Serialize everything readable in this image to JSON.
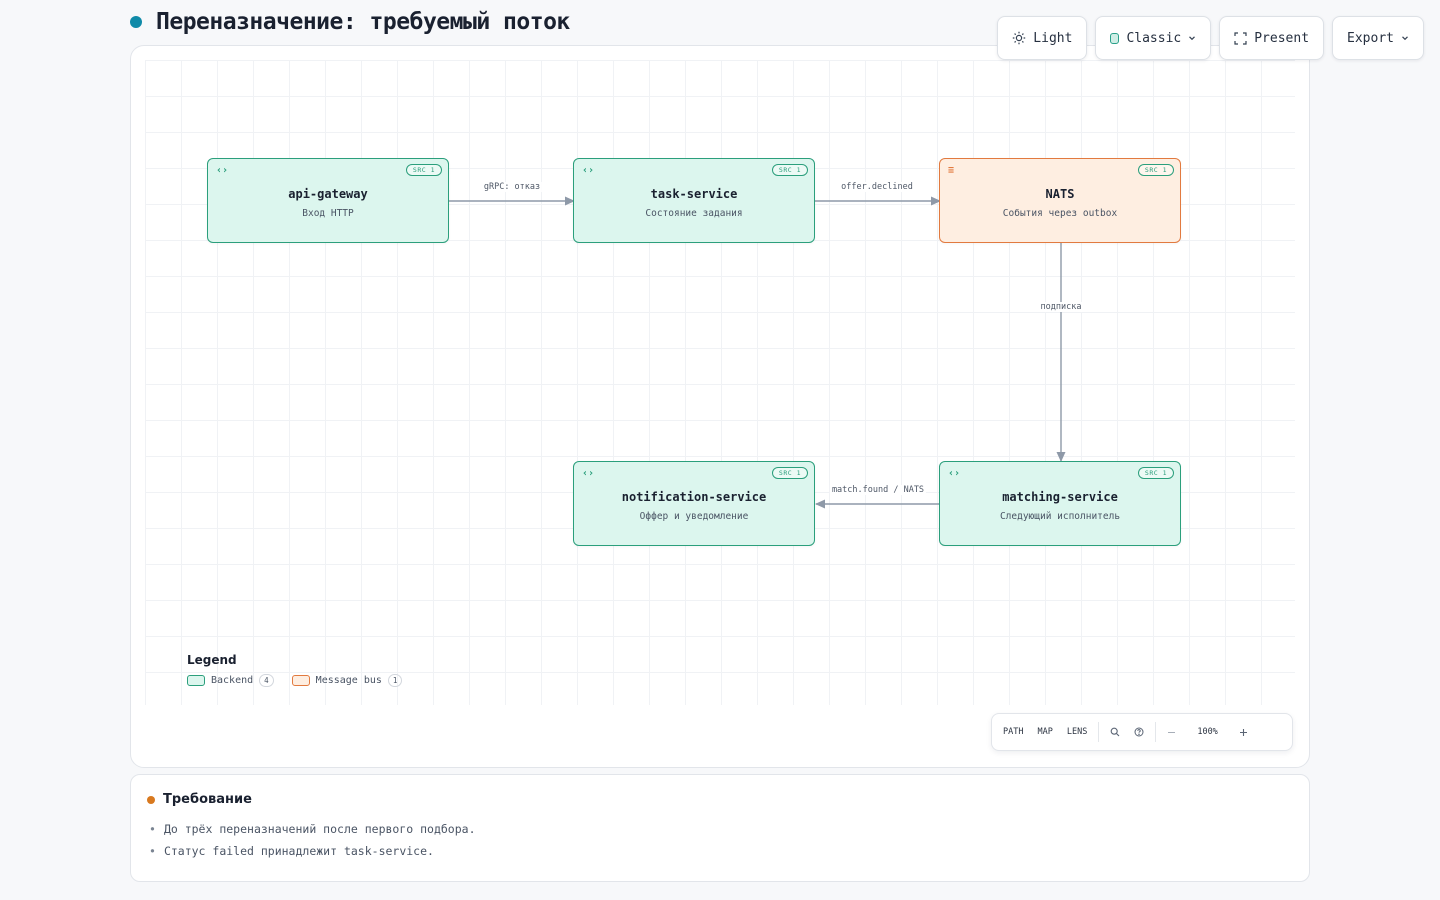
{
  "page": {
    "title": "Переназначение: требуемый поток",
    "accent": "#0f8aa8"
  },
  "toolbar": {
    "theme_label": "Light",
    "style_label": "Classic",
    "present_label": "Present",
    "export_label": "Export"
  },
  "diagram": {
    "nodes": [
      {
        "id": "api-gateway",
        "name": "api-gateway",
        "subtitle": "Вход HTTP",
        "kind": "backend",
        "badge": "SRC 1"
      },
      {
        "id": "task-service",
        "name": "task-service",
        "subtitle": "Состояние задания",
        "kind": "backend",
        "badge": "SRC 1"
      },
      {
        "id": "nats",
        "name": "NATS",
        "subtitle": "События через outbox",
        "kind": "bus",
        "badge": "SRC 1"
      },
      {
        "id": "notification-service",
        "name": "notification-service",
        "subtitle": "Оффер и уведомление",
        "kind": "backend",
        "badge": "SRC 1"
      },
      {
        "id": "matching-service",
        "name": "matching-service",
        "subtitle": "Следующий исполнитель",
        "kind": "backend",
        "badge": "SRC 1"
      }
    ],
    "edges": [
      {
        "from": "api-gateway",
        "to": "task-service",
        "label": "gRPC: отказ"
      },
      {
        "from": "task-service",
        "to": "nats",
        "label": "offer.declined"
      },
      {
        "from": "nats",
        "to": "matching-service",
        "label": "подписка"
      },
      {
        "from": "matching-service",
        "to": "notification-service",
        "label": "match.found / NATS"
      }
    ],
    "colors": {
      "backend_fill": "#dcf6ee",
      "backend_stroke": "#2b9f7c",
      "bus_fill": "#feeee1",
      "bus_stroke": "#e27a3f",
      "edge": "#8e99a8"
    }
  },
  "legend": {
    "title": "Legend",
    "items": [
      {
        "label": "Backend",
        "count": "4"
      },
      {
        "label": "Message bus",
        "count": "1"
      }
    ]
  },
  "controls": {
    "path_label": "PATH",
    "map_label": "MAP",
    "lens_label": "LENS",
    "zoom": "100%"
  },
  "requirement": {
    "title": "Требование",
    "items": [
      "До трёх переназначений после первого подбора.",
      "Статус failed принадлежит task-service."
    ]
  }
}
